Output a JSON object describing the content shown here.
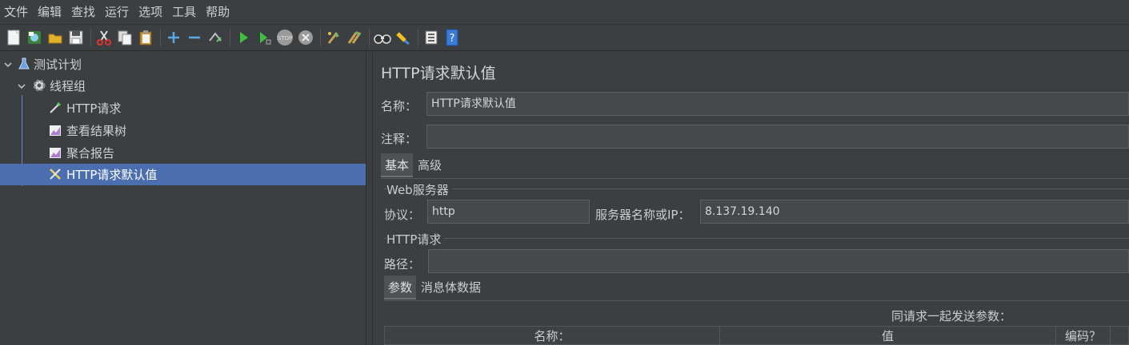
{
  "menu": [
    "文件",
    "编辑",
    "查找",
    "运行",
    "选项",
    "工具",
    "帮助"
  ],
  "toolbar": {
    "icons": [
      "new-icon",
      "template-icon",
      "open-icon",
      "save-icon",
      "cut-icon",
      "copy-icon",
      "paste-icon",
      "expand-icon",
      "collapse-icon",
      "toggle-icon",
      "start-icon",
      "start-no-pause-icon",
      "stop-icon",
      "shutdown-icon",
      "clear-icon",
      "clear-all-icon",
      "search-icon",
      "reset-search-icon",
      "function-helper-icon",
      "help-icon"
    ]
  },
  "tree": {
    "items": [
      {
        "label": "测试计划",
        "icon": "test-plan-icon"
      },
      {
        "label": "线程组",
        "icon": "gear-icon"
      },
      {
        "label": "HTTP请求",
        "icon": "pipette-icon"
      },
      {
        "label": "查看结果树",
        "icon": "chart-icon"
      },
      {
        "label": "聚合报告",
        "icon": "chart-icon"
      },
      {
        "label": "HTTP请求默认值",
        "icon": "wrench-icon"
      }
    ]
  },
  "panel": {
    "title": "HTTP请求默认值",
    "name_label": "名称：",
    "name_value": "HTTP请求默认值",
    "comment_label": "注释：",
    "comment_value": "",
    "tabs": [
      "基本",
      "高级"
    ],
    "web_server": {
      "group_title": "Web服务器",
      "protocol_label": "协议：",
      "protocol_value": "http",
      "server_label": "服务器名称或IP：",
      "server_value": "8.137.19.140"
    },
    "http_request": {
      "group_title": "HTTP请求",
      "path_label": "路径：",
      "path_value": "",
      "tabs": [
        "参数",
        "消息体数据"
      ],
      "params_caption": "同请求一起发送参数：",
      "columns": [
        "名称：",
        "值",
        "编码？",
        ""
      ]
    }
  }
}
